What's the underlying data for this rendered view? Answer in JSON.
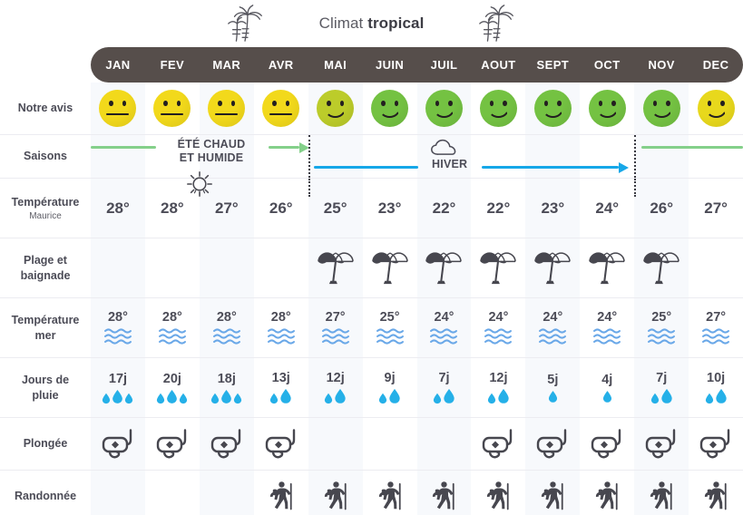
{
  "banner": {
    "title_prefix": "Climat ",
    "title_strong": "tropical",
    "left_icon": "palm-tree-icon",
    "right_icon": "palm-tree-icon"
  },
  "colors": {
    "header_bar": "#564e4b",
    "smiley_yellow": "#f2d91b",
    "smiley_yellowgreen": "#bccc2a",
    "smiley_green": "#74c242",
    "summer_green": "#84d08a",
    "winter_blue": "#16a7e8",
    "water_blue": "#6aa8e8",
    "rain_blue": "#25b0e8",
    "text_dark": "#4c4c57",
    "alt_cell": "#f7f9fc"
  },
  "months": [
    "JAN",
    "FEV",
    "MAR",
    "AVR",
    "MAI",
    "JUIN",
    "JUIL",
    "AOUT",
    "SEPT",
    "OCT",
    "NOV",
    "DEC"
  ],
  "rows": {
    "avis": {
      "label": "Notre avis"
    },
    "saisons": {
      "label": "Saisons",
      "summer_text_line1": "ÉTÉ CHAUD",
      "summer_text_line2": "ET HUMIDE",
      "winter_text": "HIVER",
      "winter_icon": "cloud-icon"
    },
    "temperature": {
      "label": "Température",
      "sublabel": "Maurice",
      "icon": "sun-icon"
    },
    "plage": {
      "label_line1": "Plage et",
      "label_line2": "baignade",
      "icon": "beach-umbrella-icon"
    },
    "mer": {
      "label_line1": "Température",
      "label_line2": "mer",
      "icon": "waves-icon"
    },
    "pluie": {
      "label_line1": "Jours de",
      "label_line2": "pluie",
      "icon": "raindrop-icon"
    },
    "plongee": {
      "label": "Plongée",
      "icon": "diving-mask-icon"
    },
    "randonnee": {
      "label": "Randonnée",
      "icon": "hiker-icon"
    }
  },
  "chart_data": {
    "type": "table",
    "title": "Climat tropical",
    "categories": [
      "JAN",
      "FEV",
      "MAR",
      "AVR",
      "MAI",
      "JUIN",
      "JUIL",
      "AOUT",
      "SEPT",
      "OCT",
      "NOV",
      "DEC"
    ],
    "series": [
      {
        "name": "Notre avis",
        "kind": "rating-smiley",
        "values": [
          "neutral",
          "neutral",
          "neutral",
          "neutral",
          "happy",
          "happy",
          "happy",
          "happy",
          "happy",
          "happy",
          "happy",
          "happy"
        ],
        "colors": [
          "#f2d91b",
          "#f2d91b",
          "#f2d91b",
          "#f2d91b",
          "#bccc2a",
          "#74c242",
          "#74c242",
          "#74c242",
          "#74c242",
          "#74c242",
          "#74c242",
          "#e8d81c"
        ]
      },
      {
        "name": "Saisons",
        "kind": "season-bands",
        "bands": [
          {
            "label": "ÉTÉ CHAUD ET HUMIDE",
            "from": "JAN",
            "to": "AVR",
            "color": "#84d08a"
          },
          {
            "label": "HIVER",
            "from": "MAI",
            "to": "OCT",
            "color": "#16a7e8"
          },
          {
            "label": "",
            "from": "NOV",
            "to": "DEC",
            "color": "#84d08a"
          }
        ]
      },
      {
        "name": "Température Maurice",
        "unit": "°",
        "values": [
          28,
          28,
          27,
          26,
          25,
          23,
          22,
          22,
          23,
          24,
          26,
          27
        ]
      },
      {
        "name": "Plage et baignade",
        "kind": "icon-presence",
        "values": [
          false,
          false,
          false,
          false,
          true,
          true,
          true,
          true,
          true,
          true,
          true,
          false
        ]
      },
      {
        "name": "Température mer",
        "unit": "°",
        "values": [
          28,
          28,
          28,
          28,
          27,
          25,
          24,
          24,
          24,
          24,
          25,
          27
        ]
      },
      {
        "name": "Jours de pluie",
        "unit": "j",
        "values": [
          17,
          20,
          18,
          13,
          12,
          9,
          7,
          12,
          5,
          4,
          7,
          10
        ],
        "drop_counts": [
          3,
          3,
          3,
          2,
          2,
          2,
          2,
          2,
          1,
          1,
          2,
          2
        ]
      },
      {
        "name": "Plongée",
        "kind": "icon-presence",
        "values": [
          true,
          true,
          true,
          true,
          false,
          false,
          false,
          true,
          true,
          true,
          true,
          true
        ]
      },
      {
        "name": "Randonnée",
        "kind": "icon-presence",
        "values": [
          false,
          false,
          false,
          true,
          true,
          true,
          true,
          true,
          true,
          true,
          true,
          true
        ]
      }
    ]
  }
}
